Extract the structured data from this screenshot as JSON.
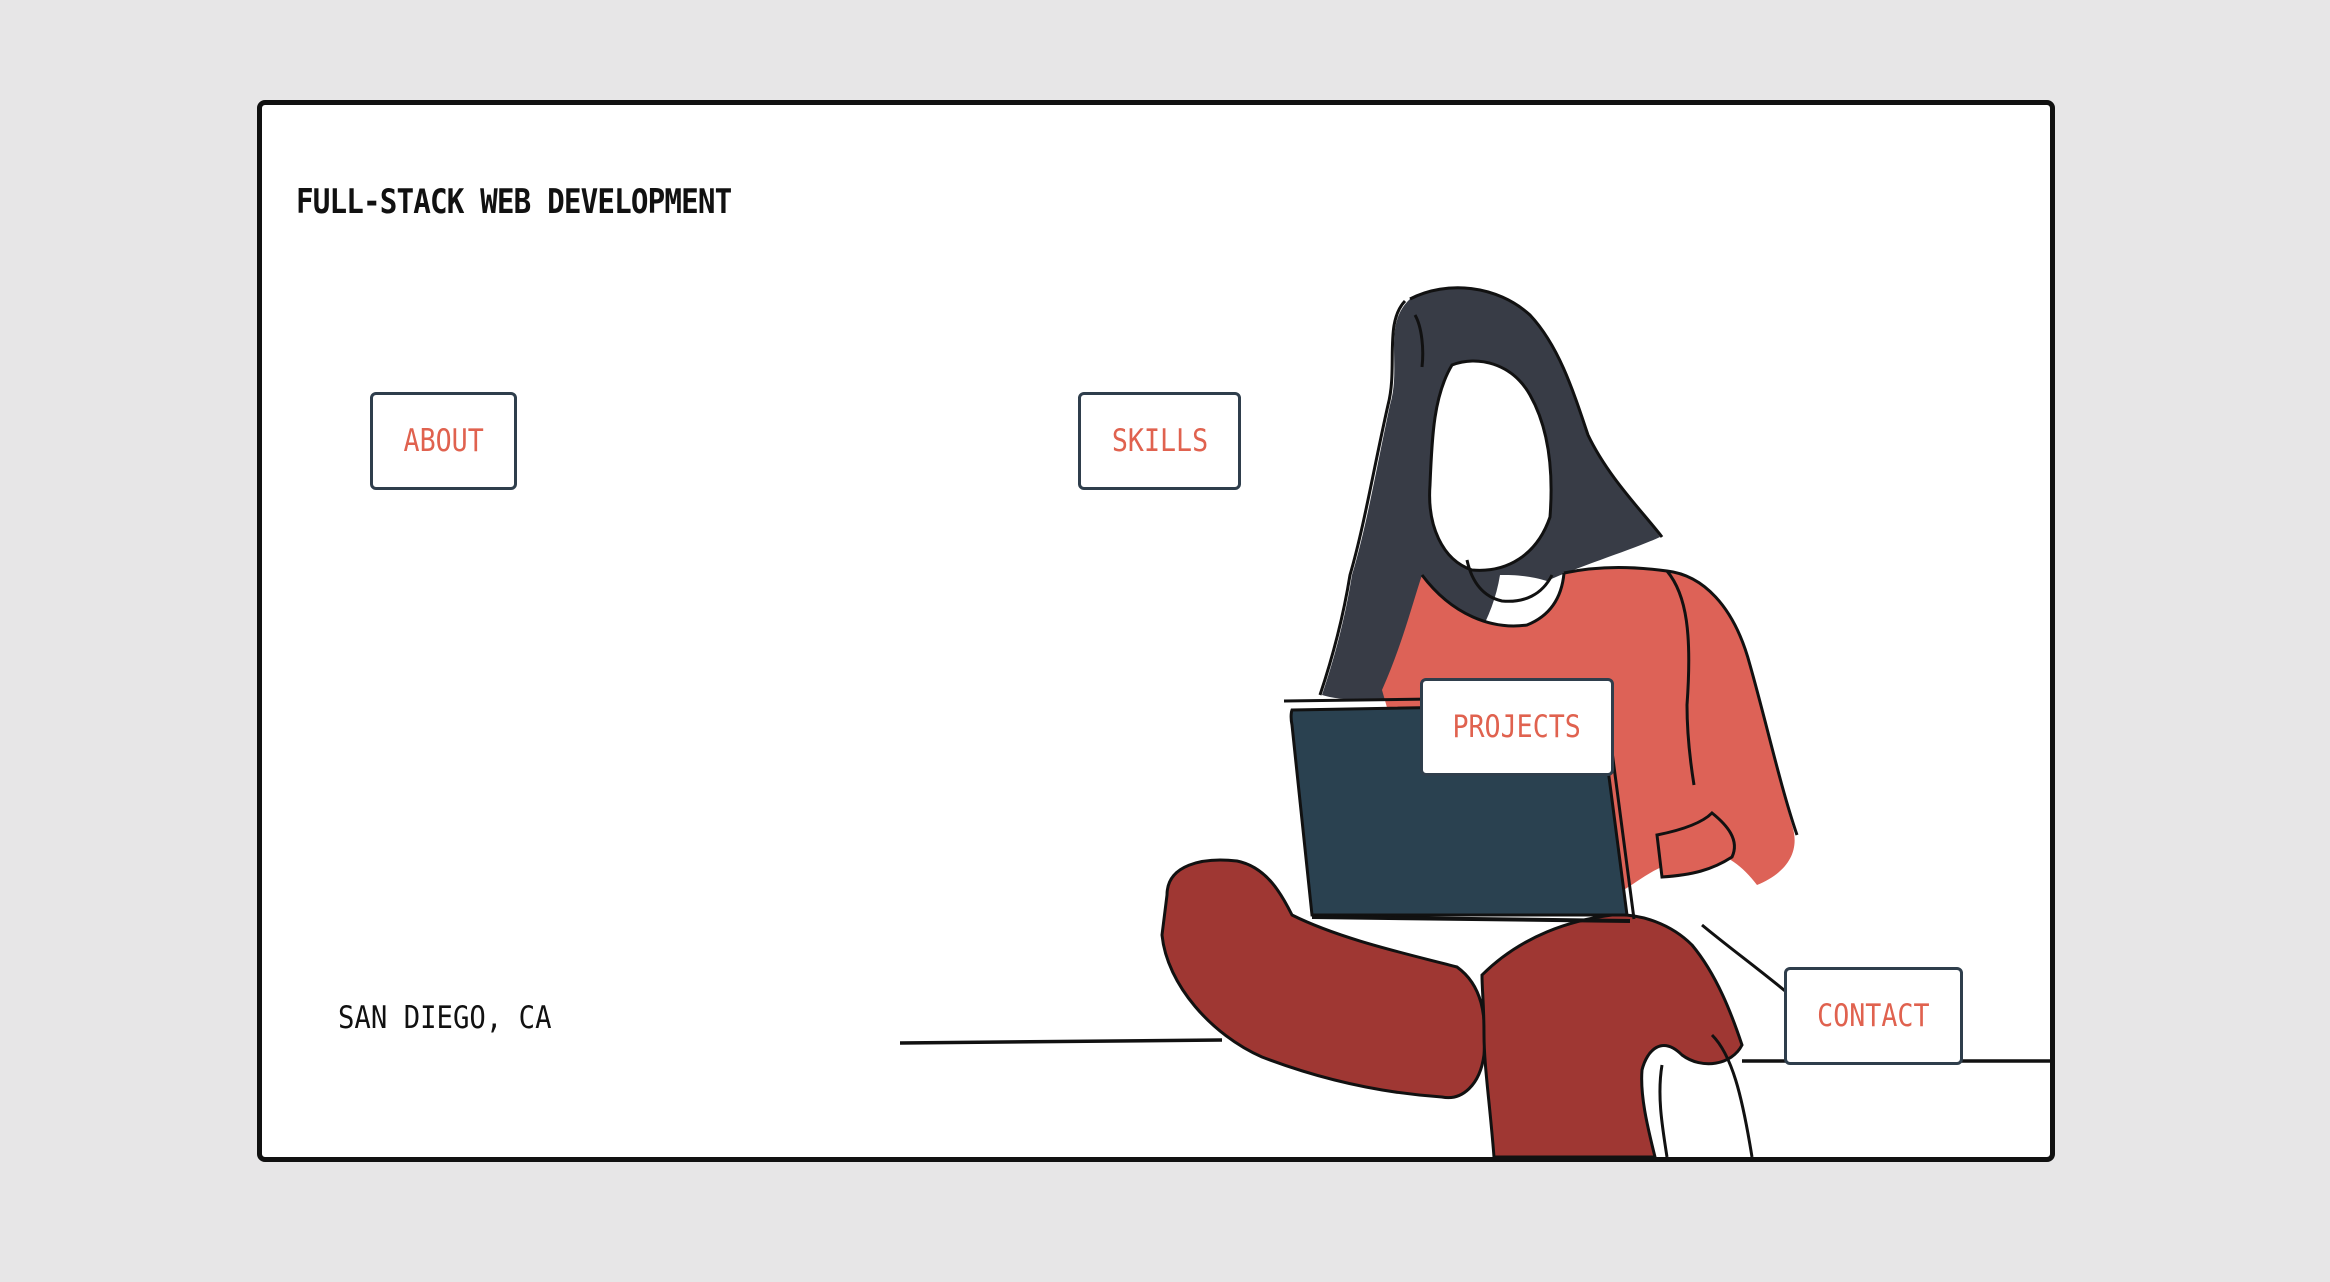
{
  "header": {
    "title": "FULL-STACK WEB DEVELOPMENT"
  },
  "nav": {
    "about": "ABOUT",
    "skills": "SKILLS",
    "projects": "PROJECTS",
    "contact": "CONTACT"
  },
  "footer": {
    "location": "SAN DIEGO, CA"
  },
  "colors": {
    "page_background": "#e7e6e7",
    "accent": "#e0624f",
    "hair": "#383c46",
    "laptop": "#2a4150",
    "shirt": "#dd6257",
    "pants": "#9f3733",
    "button_border": "#2f3e4c"
  }
}
